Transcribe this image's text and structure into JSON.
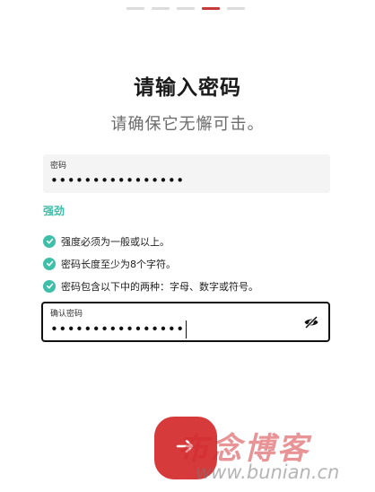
{
  "progress": {
    "total": 5,
    "current": 4
  },
  "title": "请输入密码",
  "subtitle": "请确保它无懈可击。",
  "password": {
    "label": "密码",
    "value": "••••••••••••••••"
  },
  "strength": {
    "label": "强劲",
    "color": "#3dbfa8"
  },
  "rules": [
    {
      "text": "强度必须为一般或以上。",
      "icon": "check-circle-icon"
    },
    {
      "text": "密码长度至少为8个字符。",
      "icon": "check-circle-icon"
    },
    {
      "text": "密码包含以下中的两种：字母、数字或符号。",
      "icon": "check-circle-icon"
    }
  ],
  "confirm": {
    "label": "确认密码",
    "value": "••••••••••••••••",
    "toggle_icon": "eye-slash-icon"
  },
  "next_button": {
    "icon": "arrow-right-icon",
    "color": "#d63a3a"
  },
  "watermark": {
    "text": "布念博客",
    "url": "www.bunian.cn"
  },
  "colors": {
    "accent": "#c83a3a",
    "success": "#3dbfa8"
  }
}
